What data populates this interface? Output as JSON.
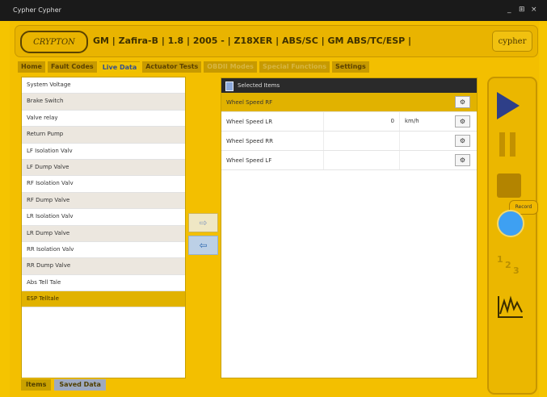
{
  "window": {
    "title": "Cypher Cypher",
    "controls": [
      "_",
      "⊞",
      "×"
    ]
  },
  "header": {
    "logo_text": "CRYPTON",
    "vehicle": "GM | Zafira-B | 1.8 | 2005 - | Z18XER | ABS/SC | GM ABS/TC/ESP |",
    "brand": "cypher"
  },
  "tabs": [
    {
      "label": "Home"
    },
    {
      "label": "Fault Codes"
    },
    {
      "label": "Live Data"
    },
    {
      "label": "Actuator Tests"
    },
    {
      "label": "OBDII Modes"
    },
    {
      "label": "Special Functions"
    },
    {
      "label": "Settings"
    }
  ],
  "available_items": [
    "System Voltage",
    "Brake Switch",
    "Valve relay",
    "Return Pump",
    "LF Isolation Valv",
    "LF Dump Valve",
    "RF Isolation Valv",
    "RF Dump Valve",
    "LR Isolation Valv",
    "LR Dump Valve",
    "RR Isolation Valv",
    "RR Dump Valve",
    "Abs Tell Tale",
    "ESP Telltale"
  ],
  "selected_items": {
    "header": "Selected Items",
    "rows": [
      {
        "name": "Wheel Speed RF",
        "value": "",
        "unit": ""
      },
      {
        "name": "Wheel Speed LR",
        "value": "0",
        "unit": "km/h"
      },
      {
        "name": "Wheel Speed RR",
        "value": "",
        "unit": ""
      },
      {
        "name": "Wheel Speed LF",
        "value": "",
        "unit": ""
      }
    ]
  },
  "bottom_tabs": [
    "Items",
    "Saved Data"
  ],
  "transfer": {
    "add": "⇨",
    "remove": "⇦"
  },
  "sidebar": {
    "record_tooltip": "Record",
    "numbers": [
      "1",
      "2",
      "3"
    ]
  }
}
